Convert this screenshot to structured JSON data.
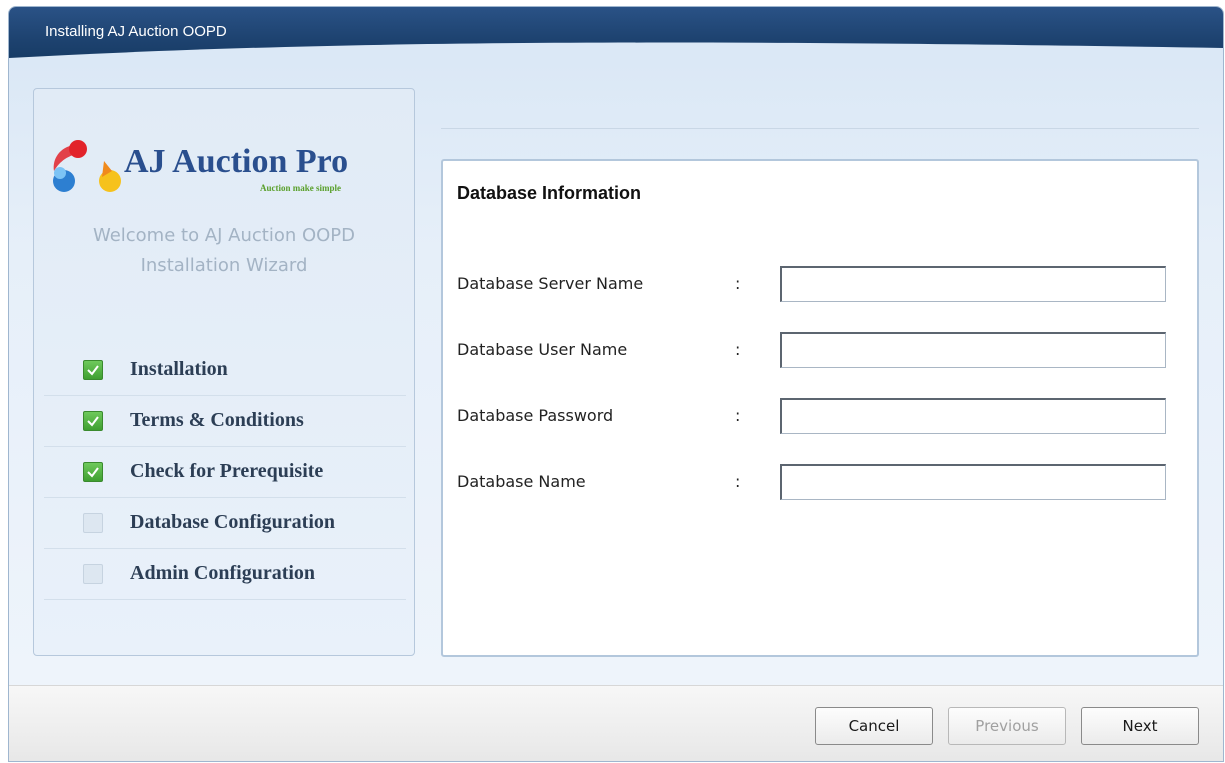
{
  "window": {
    "title": "Installing AJ Auction OOPD"
  },
  "sidebar": {
    "logo_text": "AJ Auction Pro",
    "logo_tagline": "Auction make simple",
    "welcome_line1": "Welcome to AJ Auction OOPD",
    "welcome_line2": "Installation Wizard",
    "steps": [
      {
        "label": "Installation",
        "checked": true
      },
      {
        "label": "Terms & Conditions",
        "checked": true
      },
      {
        "label": "Check for Prerequisite",
        "checked": true
      },
      {
        "label": "Database Configuration",
        "checked": false
      },
      {
        "label": "Admin Configuration",
        "checked": false
      }
    ]
  },
  "form": {
    "title": "Database Information",
    "separator": ":",
    "fields": [
      {
        "label": "Database Server Name",
        "value": ""
      },
      {
        "label": "Database User Name",
        "value": ""
      },
      {
        "label": "Database Password",
        "value": ""
      },
      {
        "label": "Database Name",
        "value": ""
      }
    ]
  },
  "buttons": {
    "cancel": "Cancel",
    "previous": "Previous",
    "next": "Next",
    "previous_enabled": false
  },
  "colors": {
    "titlebar": "#1d426f",
    "checked": "#4caf3c",
    "logo_text": "#2a4f8e",
    "tagline": "#5aa02c"
  }
}
